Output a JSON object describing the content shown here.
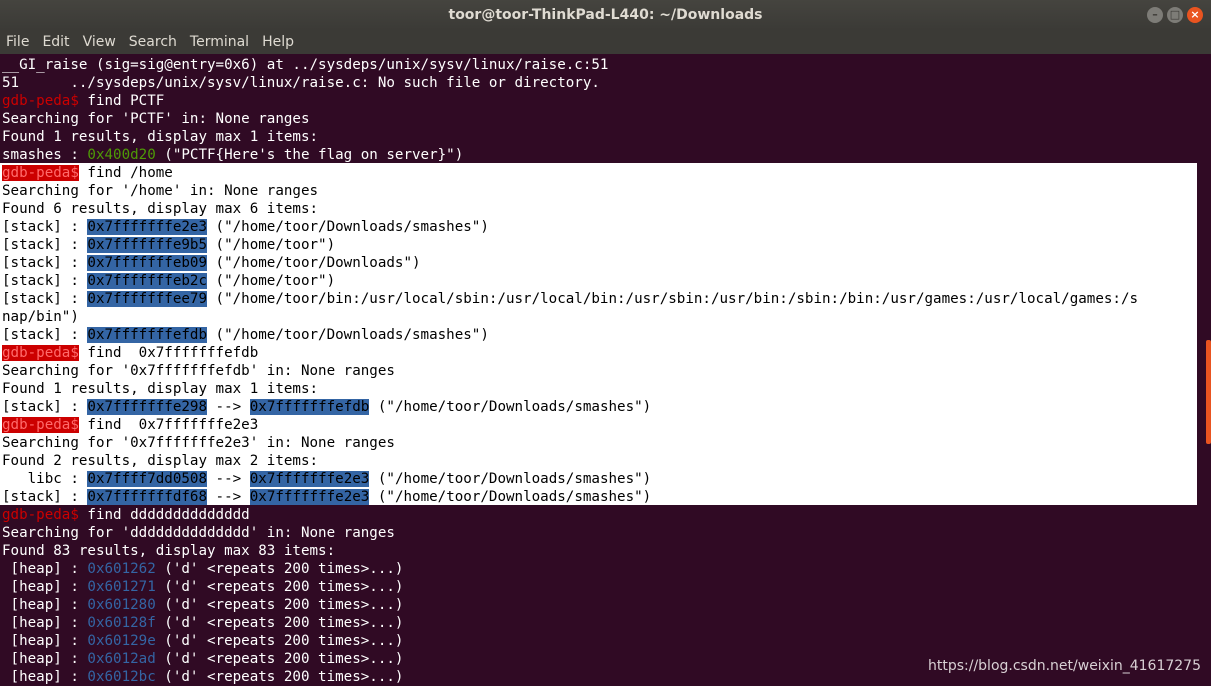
{
  "window": {
    "title": "toor@toor-ThinkPad-L440: ~/Downloads",
    "buttons": {
      "minimize": "–",
      "maximize": "□",
      "close": "×"
    }
  },
  "menu": [
    "File",
    "Edit",
    "View",
    "Search",
    "Terminal",
    "Help"
  ],
  "terminal": {
    "prompt": "gdb-peda$",
    "lines": [
      {
        "parts": [
          {
            "t": "__GI_raise (sig=sig@entry=0x6) at ../sysdeps/unix/sysv/linux/raise.c:51"
          }
        ]
      },
      {
        "parts": [
          {
            "t": "51\t../sysdeps/unix/sysv/linux/raise.c: No such file or directory."
          }
        ]
      },
      {
        "parts": [
          {
            "t": "gdb-peda$",
            "c": "prompt"
          },
          {
            "t": " find PCTF"
          }
        ]
      },
      {
        "parts": [
          {
            "t": "Searching for 'PCTF' in: None ranges"
          }
        ]
      },
      {
        "parts": [
          {
            "t": "Found 1 results, display max 1 items:"
          }
        ]
      },
      {
        "parts": [
          {
            "t": "smashes : "
          },
          {
            "t": "0x400d20",
            "c": "addr-g"
          },
          {
            "t": " (\"PCTF{Here's the flag on server}\")"
          }
        ]
      },
      {
        "sel": true,
        "parts": [
          {
            "t": "gdb-peda$",
            "c": "prompt"
          },
          {
            "t": " find /home"
          }
        ]
      },
      {
        "sel": true,
        "parts": [
          {
            "t": "Searching for '/home' in: None ranges"
          }
        ]
      },
      {
        "sel": true,
        "parts": [
          {
            "t": "Found 6 results, display max 6 items:"
          }
        ]
      },
      {
        "sel": true,
        "parts": [
          {
            "t": "[stack] : "
          },
          {
            "t": "0x7fffffffe2e3",
            "c": "hl"
          },
          {
            "t": " (\"/home/toor/Downloads/smashes\")"
          }
        ]
      },
      {
        "sel": true,
        "parts": [
          {
            "t": "[stack] : "
          },
          {
            "t": "0x7fffffffe9b5",
            "c": "hl"
          },
          {
            "t": " (\"/home/toor\")"
          }
        ]
      },
      {
        "sel": true,
        "parts": [
          {
            "t": "[stack] : "
          },
          {
            "t": "0x7fffffffeb09",
            "c": "hl"
          },
          {
            "t": " (\"/home/toor/Downloads\")"
          }
        ]
      },
      {
        "sel": true,
        "parts": [
          {
            "t": "[stack] : "
          },
          {
            "t": "0x7fffffffeb2c",
            "c": "hl"
          },
          {
            "t": " (\"/home/toor\")"
          }
        ]
      },
      {
        "sel": true,
        "parts": [
          {
            "t": "[stack] : "
          },
          {
            "t": "0x7fffffffee79",
            "c": "hl"
          },
          {
            "t": " (\"/home/toor/bin:/usr/local/sbin:/usr/local/bin:/usr/sbin:/usr/bin:/sbin:/bin:/usr/games:/usr/local/games:/s"
          }
        ]
      },
      {
        "sel": true,
        "parts": [
          {
            "t": "nap/bin\")"
          }
        ]
      },
      {
        "sel": true,
        "parts": [
          {
            "t": "[stack] : "
          },
          {
            "t": "0x7fffffffefdb",
            "c": "hl"
          },
          {
            "t": " (\"/home/toor/Downloads/smashes\")"
          }
        ]
      },
      {
        "sel": true,
        "parts": [
          {
            "t": "gdb-peda$",
            "c": "prompt"
          },
          {
            "t": " find  0x7fffffffefdb"
          }
        ]
      },
      {
        "sel": true,
        "parts": [
          {
            "t": "Searching for '0x7fffffffefdb' in: None ranges"
          }
        ]
      },
      {
        "sel": true,
        "parts": [
          {
            "t": "Found 1 results, display max 1 items:"
          }
        ]
      },
      {
        "sel": true,
        "parts": [
          {
            "t": "[stack] : "
          },
          {
            "t": "0x7fffffffe298",
            "c": "hl"
          },
          {
            "t": " --> "
          },
          {
            "t": "0x7fffffffefdb",
            "c": "hl"
          },
          {
            "t": " (\"/home/toor/Downloads/smashes\")"
          }
        ]
      },
      {
        "sel": true,
        "parts": [
          {
            "t": "gdb-peda$",
            "c": "prompt"
          },
          {
            "t": " find  0x7fffffffe2e3"
          }
        ]
      },
      {
        "sel": true,
        "parts": [
          {
            "t": "Searching for '0x7fffffffe2e3' in: None ranges"
          }
        ]
      },
      {
        "sel": true,
        "parts": [
          {
            "t": "Found 2 results, display max 2 items:"
          }
        ]
      },
      {
        "sel": true,
        "parts": [
          {
            "t": "   libc : "
          },
          {
            "t": "0x7ffff7dd0508",
            "c": "hl"
          },
          {
            "t": " --> "
          },
          {
            "t": "0x7fffffffe2e3",
            "c": "hl"
          },
          {
            "t": " (\"/home/toor/Downloads/smashes\")"
          }
        ]
      },
      {
        "sel": true,
        "parts": [
          {
            "t": "[stack] : "
          },
          {
            "t": "0x7fffffffdf68",
            "c": "hl"
          },
          {
            "t": " --> "
          },
          {
            "t": "0x7fffffffe2e3",
            "c": "hl"
          },
          {
            "t": " (\"/home/toor/Downloads/smashes\")"
          }
        ]
      },
      {
        "parts": [
          {
            "t": "gdb-peda$",
            "c": "prompt"
          },
          {
            "t": " find dddddddddddddd"
          }
        ]
      },
      {
        "parts": [
          {
            "t": "Searching for 'dddddddddddddd' in: None ranges"
          }
        ]
      },
      {
        "parts": [
          {
            "t": "Found 83 results, display max 83 items:"
          }
        ]
      },
      {
        "parts": [
          {
            "t": " [heap] : "
          },
          {
            "t": "0x601262",
            "c": "addr-b"
          },
          {
            "t": " ('d' <repeats 200 times>...)"
          }
        ]
      },
      {
        "parts": [
          {
            "t": " [heap] : "
          },
          {
            "t": "0x601271",
            "c": "addr-b"
          },
          {
            "t": " ('d' <repeats 200 times>...)"
          }
        ]
      },
      {
        "parts": [
          {
            "t": " [heap] : "
          },
          {
            "t": "0x601280",
            "c": "addr-b"
          },
          {
            "t": " ('d' <repeats 200 times>...)"
          }
        ]
      },
      {
        "parts": [
          {
            "t": " [heap] : "
          },
          {
            "t": "0x60128f",
            "c": "addr-b"
          },
          {
            "t": " ('d' <repeats 200 times>...)"
          }
        ]
      },
      {
        "parts": [
          {
            "t": " [heap] : "
          },
          {
            "t": "0x60129e",
            "c": "addr-b"
          },
          {
            "t": " ('d' <repeats 200 times>...)"
          }
        ]
      },
      {
        "parts": [
          {
            "t": " [heap] : "
          },
          {
            "t": "0x6012ad",
            "c": "addr-b"
          },
          {
            "t": " ('d' <repeats 200 times>...)"
          }
        ]
      },
      {
        "parts": [
          {
            "t": " [heap] : "
          },
          {
            "t": "0x6012bc",
            "c": "addr-b"
          },
          {
            "t": " ('d' <repeats 200 times>...)"
          }
        ]
      }
    ]
  },
  "watermark": "https://blog.csdn.net/weixin_41617275",
  "colors": {
    "background": "#300a24",
    "prompt": "#cc0000",
    "address_green": "#4e9a06",
    "address_blue": "#3465a4",
    "scrollbar": "#e95420"
  }
}
